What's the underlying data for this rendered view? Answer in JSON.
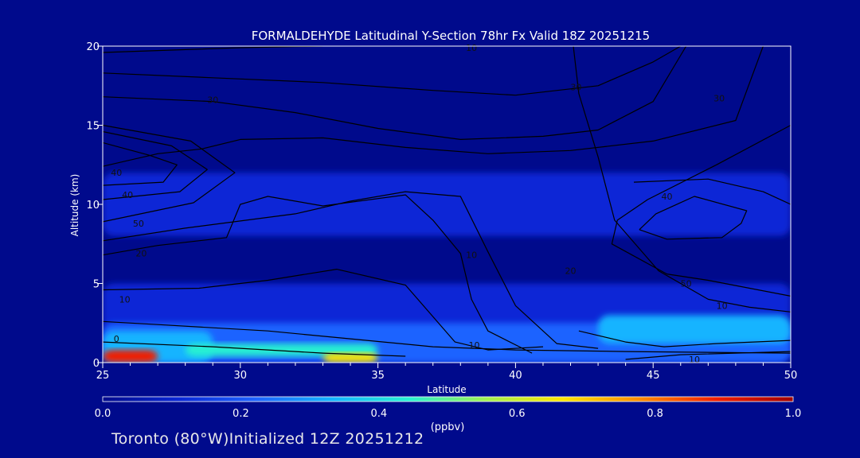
{
  "chart_data": {
    "type": "heatmap",
    "title": "FORMALDEHYDE Latitudinal Y-Section 78hr  Fx Valid 18Z 20251215",
    "xlabel": "Latitude",
    "ylabel": "Altitude (km)",
    "xlim": [
      25,
      50
    ],
    "ylim": [
      0,
      20
    ],
    "x_ticks": [
      "25",
      "30",
      "35",
      "40",
      "45",
      "50"
    ],
    "y_ticks": [
      "0",
      "5",
      "10",
      "15",
      "20"
    ],
    "colorbar": {
      "label": "(ppbv)",
      "range": [
        0.0,
        1.0
      ],
      "ticks": [
        "0.0",
        "0.2",
        "0.4",
        "0.6",
        "0.8",
        "1.0"
      ],
      "colors": [
        "#000a8c",
        "#0a28d6",
        "#1e64ff",
        "#14b4ff",
        "#28f0d2",
        "#a0f050",
        "#ffe600",
        "#ff8c00",
        "#f01e00",
        "#a00000"
      ]
    },
    "concentration_regions": [
      {
        "lat_range": [
          25,
          50
        ],
        "alt_range": [
          0,
          20
        ],
        "value": 0.03
      },
      {
        "lat_range": [
          25,
          50
        ],
        "alt_range": [
          8,
          12
        ],
        "value": 0.08
      },
      {
        "lat_range": [
          25,
          50
        ],
        "alt_range": [
          0,
          5
        ],
        "value": 0.12
      },
      {
        "lat_range": [
          25,
          50
        ],
        "alt_range": [
          0,
          2.5
        ],
        "value": 0.18
      },
      {
        "lat_range": [
          43,
          50
        ],
        "alt_range": [
          1.2,
          3
        ],
        "value": 0.3
      },
      {
        "lat_range": [
          25,
          29
        ],
        "alt_range": [
          0,
          2
        ],
        "value": 0.35
      },
      {
        "lat_range": [
          28,
          35
        ],
        "alt_range": [
          0.4,
          1.2
        ],
        "value": 0.45
      },
      {
        "lat_range": [
          33,
          35
        ],
        "alt_range": [
          0,
          0.6
        ],
        "value": 0.65
      },
      {
        "lat_range": [
          25,
          27
        ],
        "alt_range": [
          0,
          0.8
        ],
        "value": 0.85
      }
    ],
    "contour_labels": [
      "10",
      "30",
      "30",
      "30",
      "40",
      "40",
      "50",
      "20",
      "10",
      "0",
      "10",
      "10",
      "40",
      "20",
      "10",
      "50",
      "10"
    ]
  },
  "footer": {
    "text": "Toronto (80°W)Initialized 12Z 20251212"
  }
}
